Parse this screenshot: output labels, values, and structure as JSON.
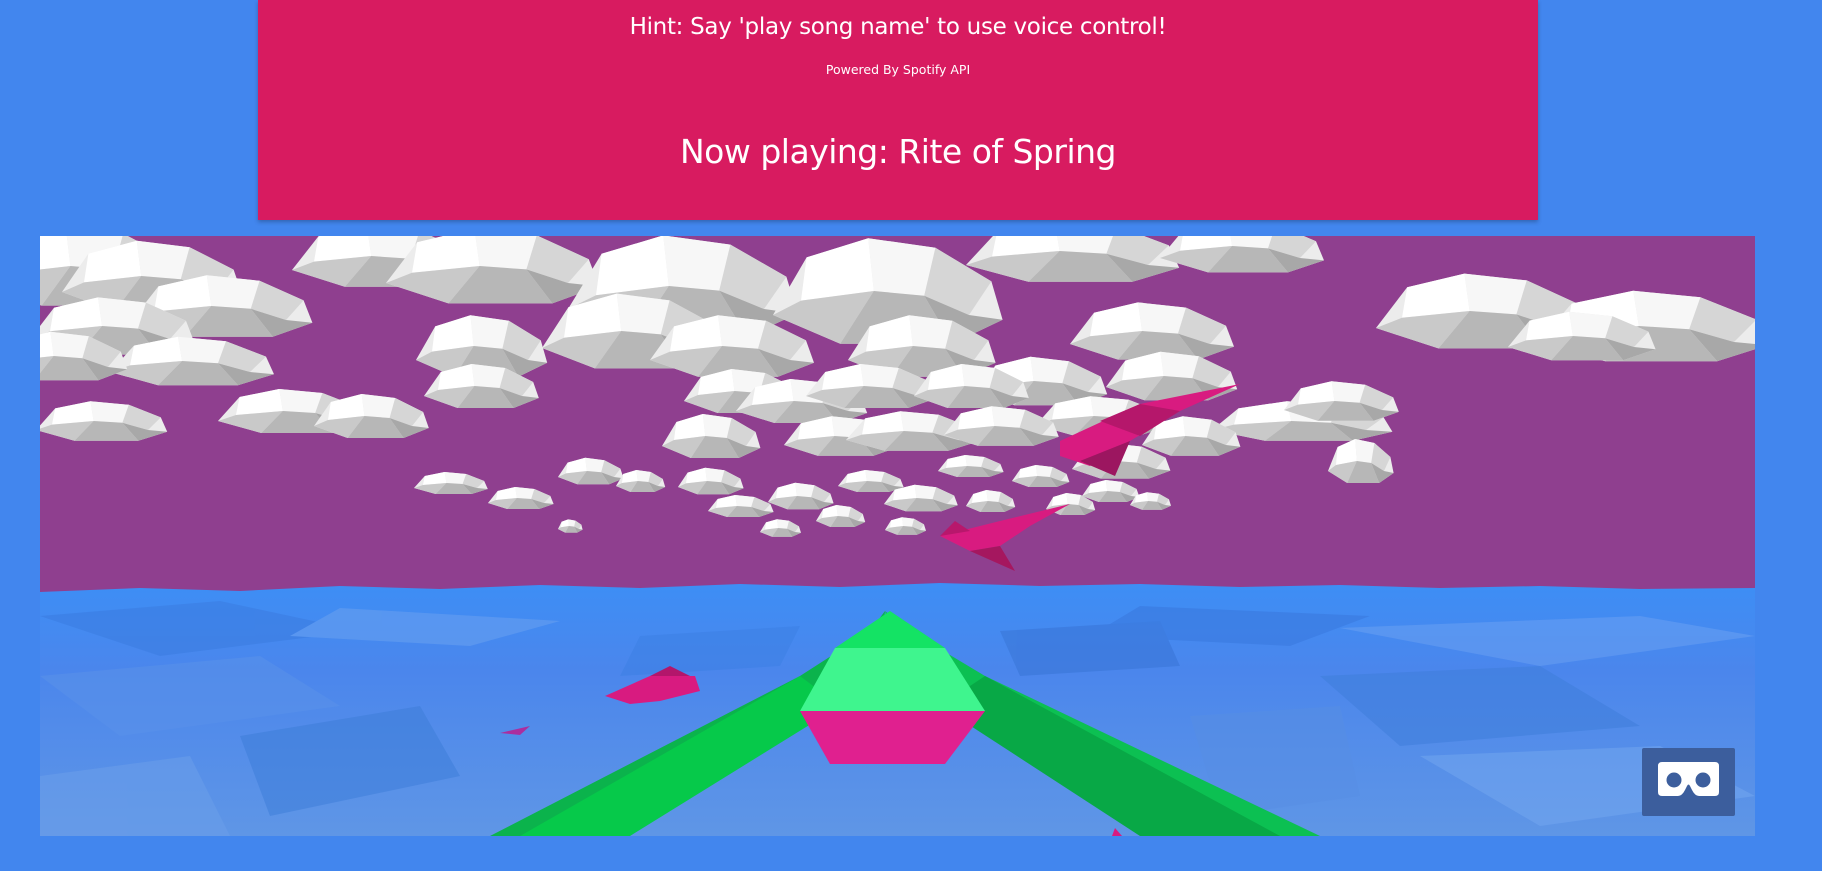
{
  "header": {
    "hint": "Hint: Say 'play song name' to use voice control!",
    "powered_by": "Powered By Spotify API",
    "now_playing": "Now playing: Rite of Spring"
  },
  "colors": {
    "page_background": "#4286ee",
    "header_background": "#d81b60",
    "sky": "#8f3f8f",
    "water": "#4e86ee",
    "boat_green": "#0bd855",
    "fish_pink": "#d81b80",
    "cloud": "#e8e8e8",
    "vr_button": "#3c5e9d"
  },
  "scene": {
    "icons": [
      "vr-headset-icon"
    ]
  }
}
